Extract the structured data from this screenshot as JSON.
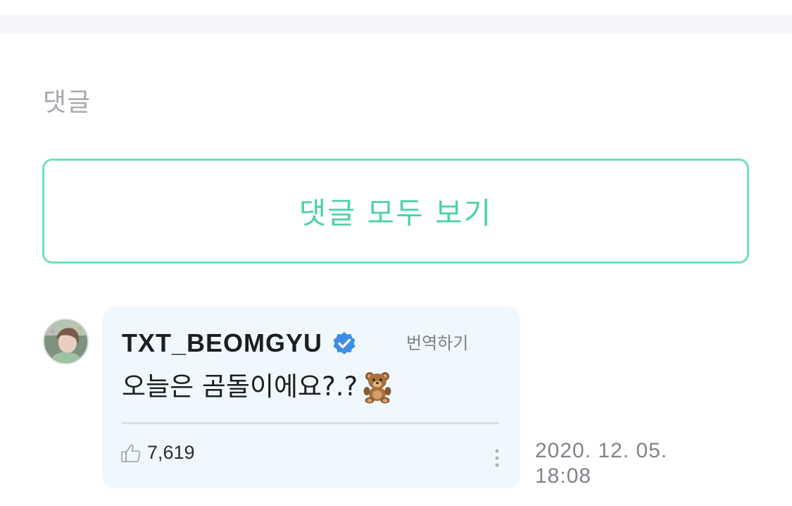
{
  "section": {
    "title": "댓글",
    "view_all_label": "댓글 모두 보기",
    "accent_color": "#4fd1ab"
  },
  "comment": {
    "author": "TXT_BEOMGYU",
    "verified": true,
    "verified_icon": "verified-badge-icon",
    "translate_label": "번역하기",
    "text": "오늘은 곰돌이에요?.?",
    "emoji": "teddy-bear-icon",
    "likes": "7,619",
    "like_icon": "thumbs-up-icon",
    "more_icon": "vertical-ellipsis-icon",
    "timestamp": "2020. 12. 05. 18:08"
  }
}
